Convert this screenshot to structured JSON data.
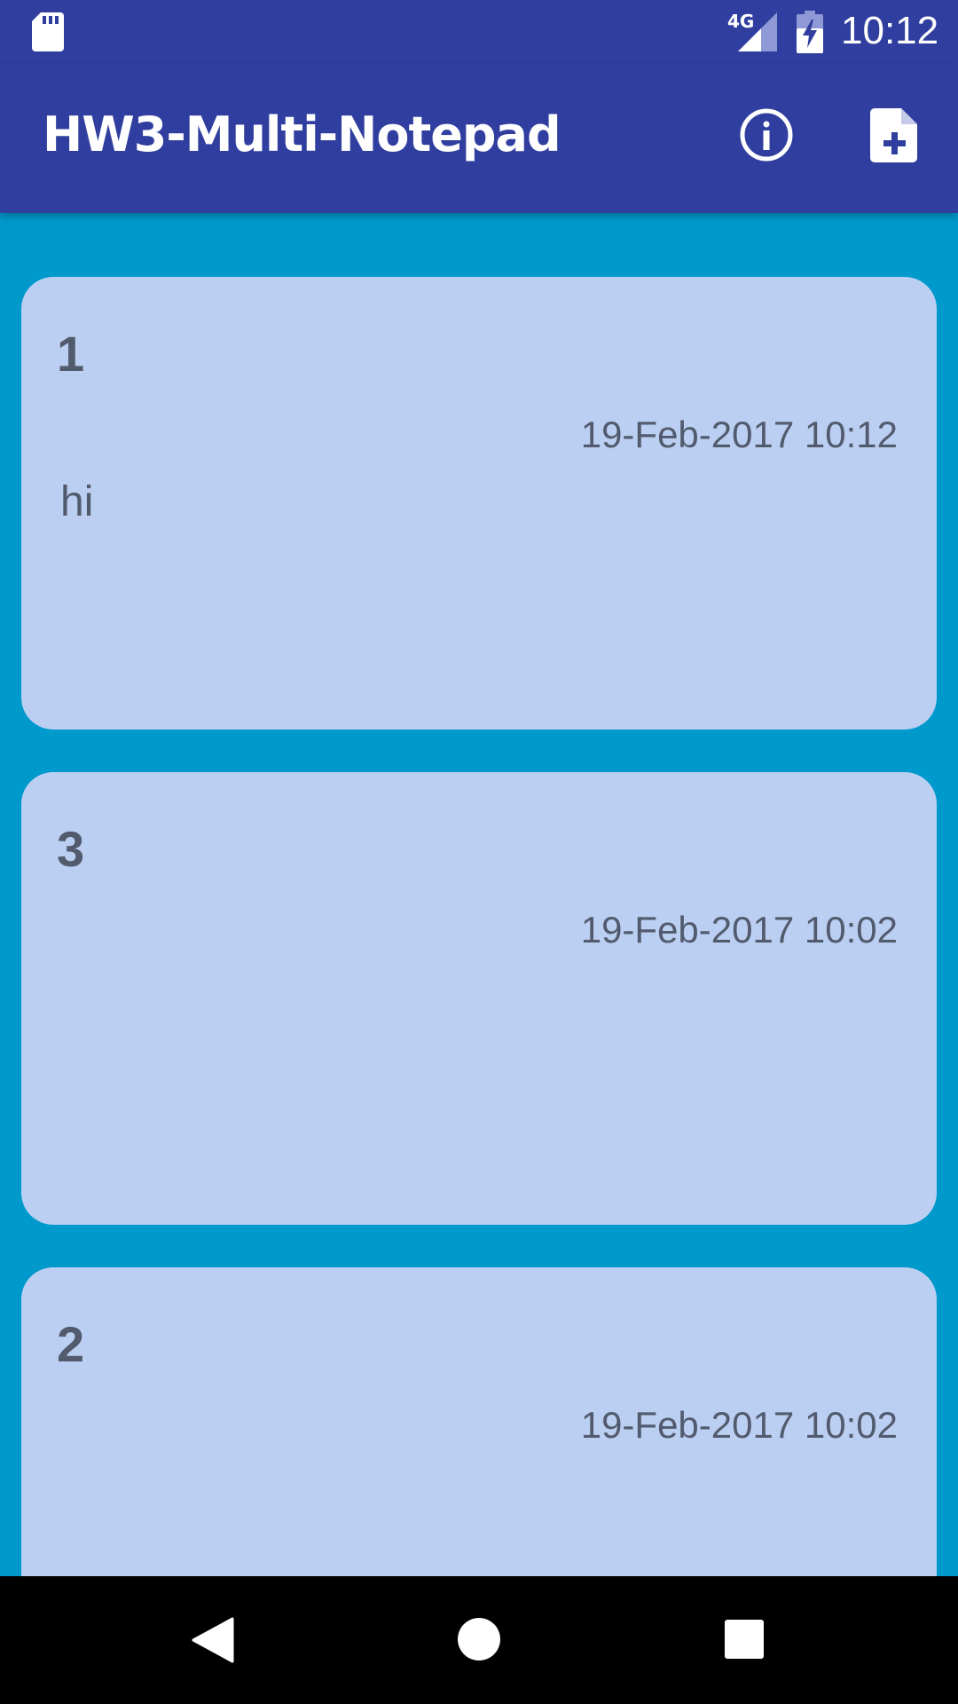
{
  "status_bar": {
    "network": "4G",
    "time": "10:12",
    "icons": [
      "sd-card-icon",
      "signal-icon",
      "battery-charging-icon"
    ]
  },
  "app_bar": {
    "title": "HW3-Multi-Notepad",
    "actions": [
      {
        "name": "info",
        "icon": "info-icon"
      },
      {
        "name": "new-note",
        "icon": "note-add-icon"
      }
    ]
  },
  "notes": [
    {
      "title": "1",
      "date": "19-Feb-2017 10:12",
      "body": "hi"
    },
    {
      "title": "3",
      "date": "19-Feb-2017 10:02",
      "body": ""
    },
    {
      "title": "2",
      "date": "19-Feb-2017 10:02",
      "body": ""
    }
  ],
  "nav_bar": {
    "icons": [
      "back-icon",
      "home-icon",
      "recents-icon"
    ]
  },
  "colors": {
    "primary_dark": "#303F9F",
    "background": "#0099CC",
    "card": "#BBCFF2",
    "card_text": "#525B6E"
  }
}
